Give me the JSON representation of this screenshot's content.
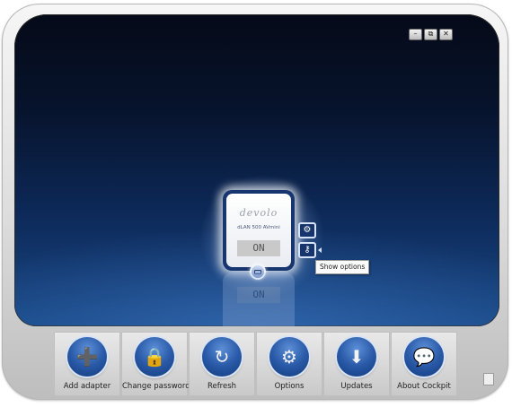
{
  "window": {
    "controls": [
      {
        "name": "minimize",
        "glyph": "–"
      },
      {
        "name": "restore",
        "glyph": "⧉"
      },
      {
        "name": "close",
        "glyph": "✕"
      }
    ]
  },
  "adapter": {
    "logo": "devolo",
    "model": "dLAN 500 AVmini",
    "status": "ON",
    "tooltip": "Show options",
    "icons": [
      "tools-icon",
      "key-icon"
    ]
  },
  "toolbar": {
    "items": [
      {
        "label": "Add adapter",
        "icon": "add-adapter-icon",
        "glyph": "➕"
      },
      {
        "label": "Change password",
        "icon": "lock-icon",
        "glyph": "🔒"
      },
      {
        "label": "Refresh",
        "icon": "refresh-icon",
        "glyph": "↻"
      },
      {
        "label": "Options",
        "icon": "gears-icon",
        "glyph": "⚙"
      },
      {
        "label": "Updates",
        "icon": "download-arrow-icon",
        "glyph": "⬇"
      },
      {
        "label": "About Cockpit",
        "icon": "speech-bubble-icon",
        "glyph": "💬"
      }
    ]
  },
  "colors": {
    "screen_top": "#050a18",
    "screen_bottom": "#1a4a88",
    "accent": "#2a5aa8"
  }
}
